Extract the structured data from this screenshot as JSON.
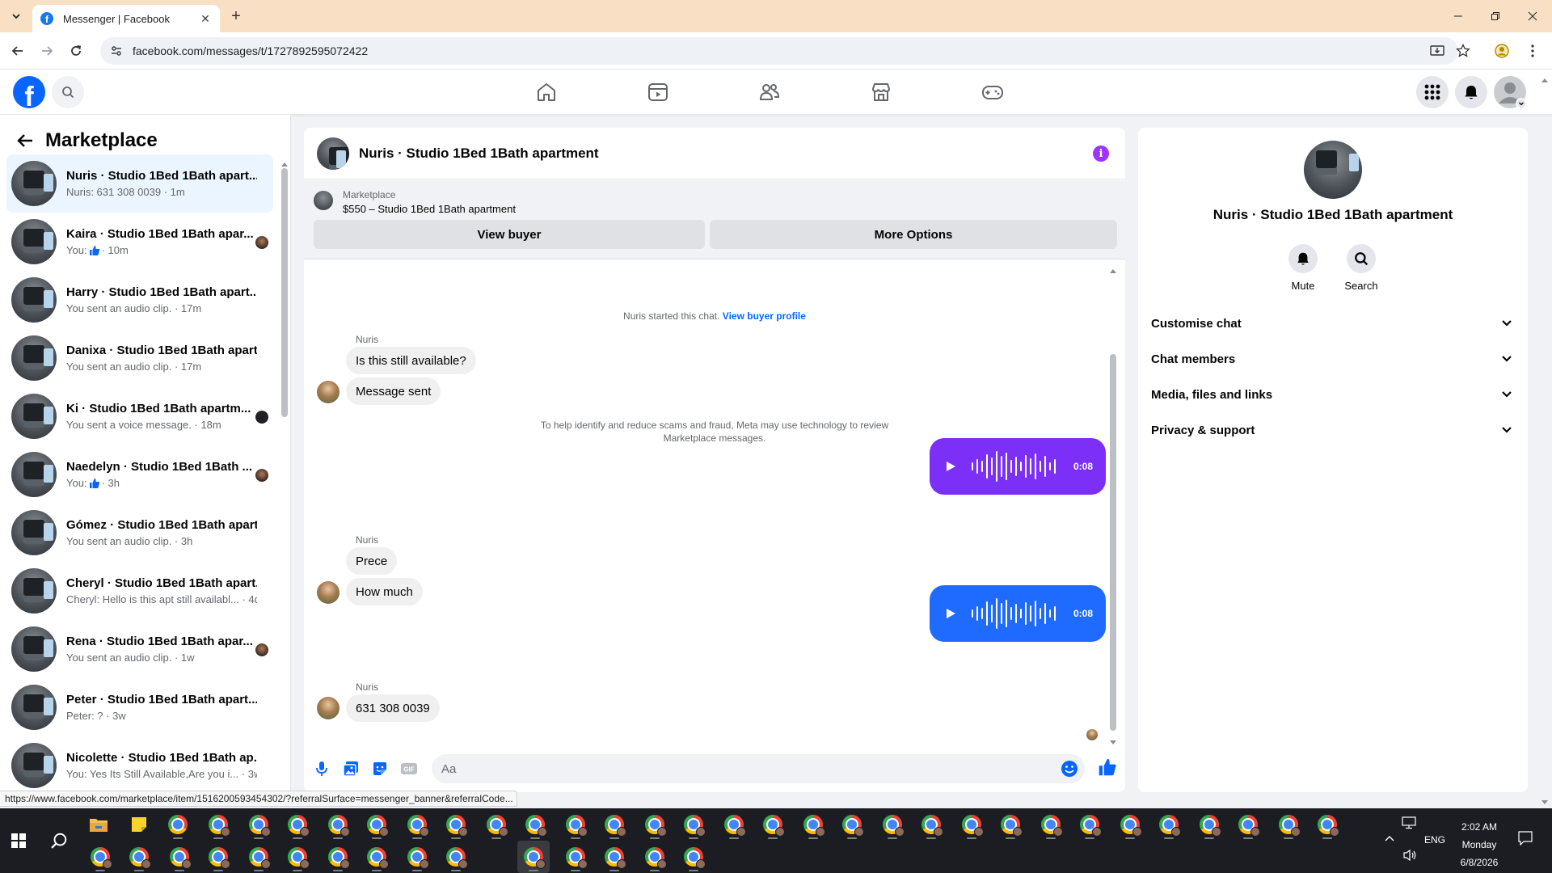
{
  "browser": {
    "tab_title": "Messenger | Facebook",
    "url": "facebook.com/messages/t/1727892595072422",
    "status_url": "https://www.facebook.com/marketplace/item/1516200593454302/?referralSurface=messenger_banner&referralCode..."
  },
  "sidebar": {
    "title": "Marketplace",
    "conversations": [
      {
        "name": "Nuris · Studio 1Bed 1Bath apart...",
        "snippet": "Nuris: 631 308 0039 · 1m",
        "active": true
      },
      {
        "name": "Kaira · Studio 1Bed 1Bath apar...",
        "snippet_prefix": "You:",
        "snippet": "· 10m",
        "thumb": true
      },
      {
        "name": "Harry · Studio 1Bed 1Bath apart...",
        "snippet": "You sent an audio clip. · 17m"
      },
      {
        "name": "Danixa · Studio 1Bed 1Bath apart...",
        "snippet": "You sent an audio clip. · 17m"
      },
      {
        "name": "Ki · Studio 1Bed 1Bath apartm...",
        "snippet": "You sent a voice message. · 18m"
      },
      {
        "name": "Naedelyn · Studio 1Bed 1Bath ...",
        "snippet_prefix": "You:",
        "snippet": "· 3h",
        "thumb": true
      },
      {
        "name": "Gómez · Studio 1Bed 1Bath apart...",
        "snippet": "You sent an audio clip. · 3h"
      },
      {
        "name": "Cheryl · Studio 1Bed 1Bath apart...",
        "snippet": "Cheryl: Hello is this apt still availabl... · 4d"
      },
      {
        "name": "Rena · Studio 1Bed 1Bath apar...",
        "snippet": "You sent an audio clip. · 1w"
      },
      {
        "name": "Peter · Studio 1Bed 1Bath apart...",
        "snippet": "Peter: ? · 3w"
      },
      {
        "name": "Nicolette · Studio 1Bed 1Bath ap...",
        "snippet": "You: Yes Its Still Available,Are you i... · 3w"
      }
    ]
  },
  "chat": {
    "title": "Nuris · Studio 1Bed 1Bath apartment",
    "banner_label": "Marketplace",
    "banner_item": "$550 – Studio 1Bed 1Bath apartment",
    "view_buyer": "View buyer",
    "more_options": "More Options",
    "started_text": "Nuris started this chat.",
    "view_profile": "View buyer profile",
    "sender_name": "Nuris",
    "msg1": "Is this still available?",
    "msg2": "Message sent",
    "meta_notice_1": "To help identify and reduce scams and fraud, Meta may use technology to review",
    "meta_notice_2": "Marketplace messages.",
    "audio1_duration": "0:08",
    "msg3": "Prece",
    "msg4": "How much",
    "audio2_duration": "0:08",
    "msg5": "631 308 0039",
    "composer_placeholder": "Aa",
    "colors": {
      "audio": "#7b2ff7",
      "audio2": "#1f6bff",
      "accent": "#0866ff",
      "info": "#a033ff"
    }
  },
  "info_panel": {
    "name": "Nuris · Studio 1Bed 1Bath apartment",
    "mute": "Mute",
    "search": "Search",
    "sections": [
      "Customise chat",
      "Chat members",
      "Media, files and links",
      "Privacy & support"
    ]
  },
  "taskbar": {
    "time": "2:02 AM",
    "day": "Monday",
    "date": "6/8/2026",
    "lang": "ENG"
  }
}
